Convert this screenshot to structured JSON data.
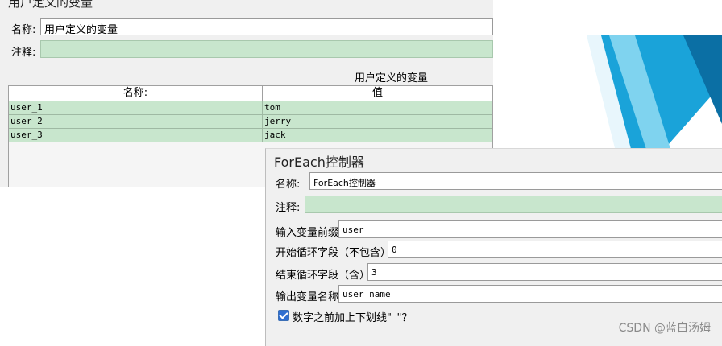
{
  "colors": {
    "accent_blue": "#1aa3d9",
    "dark_blue": "#0b6fa4",
    "green_fill": "#c8e6cd"
  },
  "variables_panel": {
    "title": "用户定义的变量",
    "name_label": "名称:",
    "name_value": "用户定义的变量",
    "comment_label": "注释:",
    "comment_value": "",
    "table": {
      "caption": "用户定义的变量",
      "columns": [
        "名称:",
        "值"
      ],
      "rows": [
        {
          "name": "user_1",
          "value": "tom"
        },
        {
          "name": "user_2",
          "value": "jerry"
        },
        {
          "name": "user_3",
          "value": "jack"
        }
      ]
    }
  },
  "foreach_panel": {
    "title": "ForEach控制器",
    "name_label": "名称:",
    "name_value": "ForEach控制器",
    "comment_label": "注释:",
    "comment_value": "",
    "input_prefix_label": "输入变量前缀",
    "input_prefix_value": "user",
    "start_label": "开始循环字段（不包含）",
    "start_value": "0",
    "end_label": "结束循环字段（含）",
    "end_value": "3",
    "output_label": "输出变量名称",
    "output_value": "user_name",
    "underscore_checkbox_label": "数字之前加上下划线\"_\"？",
    "underscore_checked": true
  },
  "watermark": "CSDN @蓝白汤姆"
}
